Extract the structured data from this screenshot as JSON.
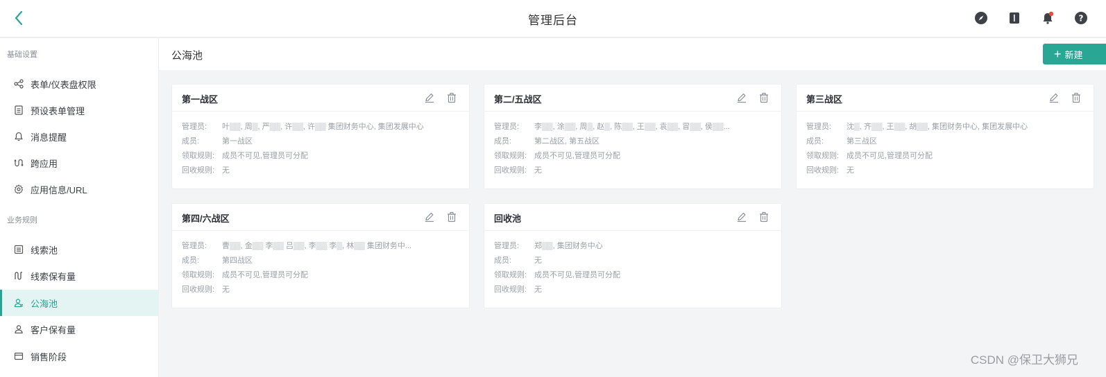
{
  "header": {
    "title": "管理后台",
    "icons": [
      "compass-icon",
      "book-icon",
      "notification-icon",
      "help-icon"
    ],
    "accent": "#2aa695"
  },
  "sidebar": {
    "sections": [
      {
        "title": "基础设置",
        "items": [
          {
            "label": "表单/仪表盘权限",
            "icon": "share-icon"
          },
          {
            "label": "预设表单管理",
            "icon": "form-icon"
          },
          {
            "label": "消息提醒",
            "icon": "bell-icon"
          },
          {
            "label": "跨应用",
            "icon": "cross-app-icon"
          },
          {
            "label": "应用信息/URL",
            "icon": "gear-icon"
          }
        ]
      },
      {
        "title": "业务规则",
        "items": [
          {
            "label": "线索池",
            "icon": "list-icon"
          },
          {
            "label": "线索保有量",
            "icon": "wave-icon"
          },
          {
            "label": "公海池",
            "icon": "user-pool-icon",
            "active": true
          },
          {
            "label": "客户保有量",
            "icon": "user-icon"
          },
          {
            "label": "销售阶段",
            "icon": "card-icon"
          }
        ]
      }
    ]
  },
  "main": {
    "title": "公海池",
    "new_button": "新建",
    "field_labels": {
      "admins": "管理员:",
      "members": "成员:",
      "claim": "领取规则:",
      "recycle": "回收规则:"
    },
    "cards": [
      {
        "title": "第一战区",
        "admins": "叶▒▒, 周▒, 严▒▒, 许▒▒, 许▒▒ 集团财务中心, 集团发展中心",
        "members": "第一战区",
        "claim": "成员不可见,管理员可分配",
        "recycle": "无"
      },
      {
        "title": "第二/五战区",
        "admins": "李▒▒, 涂▒▒, 周▒, 赵▒, 陈▒▒, 王▒▒, 袁▒▒, 冒▒▒, 侯▒▒...",
        "members": "第二战区, 第五战区",
        "claim": "成员不可见,管理员可分配",
        "recycle": "无"
      },
      {
        "title": "第三战区",
        "admins": "沈▒, 齐▒▒, 王▒▒, 胡▒▒, 集团财务中心, 集团发展中心",
        "members": "第三战区",
        "claim": "成员不可见,管理员可分配",
        "recycle": "无"
      },
      {
        "title": "第四/六战区",
        "admins": "曹▒▒, 金▒▒ 李▒▒ 吕▒▒, 李▒▒ 李▒, 林▒▒ 集团财务中...",
        "members": "第四战区",
        "claim": "成员不可见,管理员可分配",
        "recycle": "无"
      },
      {
        "title": "回收池",
        "admins": "郑▒▒, 集团财务中心",
        "members": "无",
        "claim": "成员不可见,管理员可分配",
        "recycle": "无"
      }
    ]
  },
  "watermark": "CSDN @保卫大狮兄"
}
